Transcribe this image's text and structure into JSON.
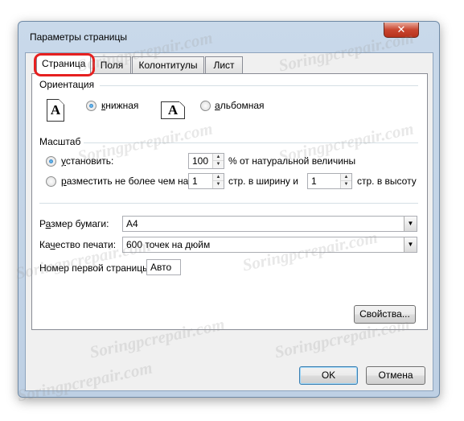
{
  "window": {
    "title": "Параметры страницы",
    "close_glyph": "✕"
  },
  "tabs": [
    {
      "label": "Страница",
      "active": true
    },
    {
      "label": "Поля",
      "active": false
    },
    {
      "label": "Колонтитулы",
      "active": false
    },
    {
      "label": "Лист",
      "active": false
    }
  ],
  "orientation": {
    "title": "Ориентация",
    "portrait": {
      "label_u": "к",
      "label_rest": "нижная",
      "checked": true,
      "icon_glyph": "A"
    },
    "landscape": {
      "label_u": "а",
      "label_rest": "льбомная",
      "checked": false,
      "icon_glyph": "A"
    }
  },
  "scaling": {
    "title": "Масштаб",
    "set": {
      "label_u": "у",
      "label_rest": "становить:",
      "checked": true,
      "value": "100",
      "suffix": "% от натуральной величины"
    },
    "fit": {
      "label_pre": "р",
      "label_rest": "азместить не более чем на:",
      "checked": false,
      "wide_value": "1",
      "wide_suffix": "стр. в ширину и",
      "tall_value": "1",
      "tall_suffix": "стр. в высоту"
    }
  },
  "paper_size": {
    "label_pre": "Р",
    "label_u": "а",
    "label_rest": "змер бумаги:",
    "value": "A4"
  },
  "print_quality": {
    "label_pre": "Ка",
    "label_u": "ч",
    "label_rest": "ество печати:",
    "value": "600 точек на дюйм"
  },
  "first_page": {
    "label": "Номер первой страницы:",
    "value": "Авто"
  },
  "buttons": {
    "properties": "Свойства...",
    "ok": "OK",
    "cancel": "Отмена"
  },
  "watermark_text": "Soringpcrepair.com",
  "colors": {
    "highlight": "#e62020",
    "titlebar": "#c9d9ea",
    "close": "#c9452f"
  }
}
